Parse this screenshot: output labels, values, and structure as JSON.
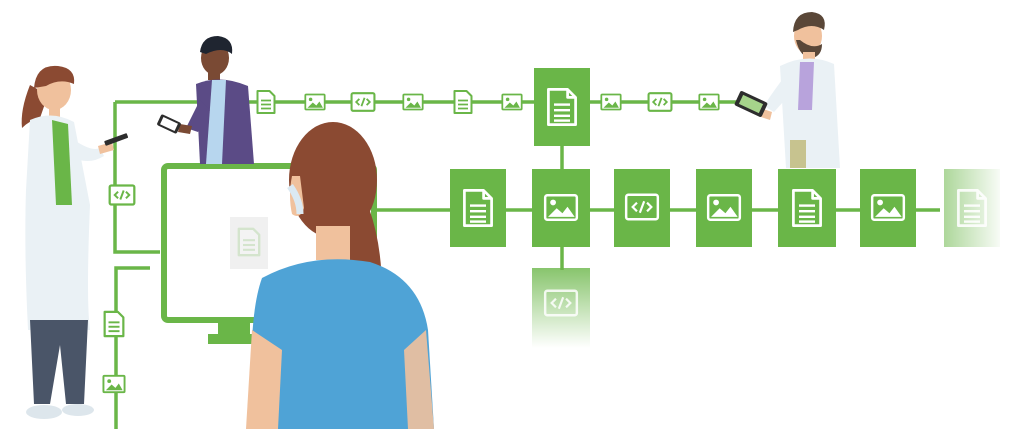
{
  "colors": {
    "accent": "#6ab648",
    "accent_light": "#e6f2df",
    "background": "#ffffff",
    "coat": "#eaf1f5",
    "scrubs_blue": "#4fa3d6",
    "hair_brown": "#8b4a32",
    "skin_tan": "#f0c19d",
    "skin_brown": "#7a4a34",
    "purple": "#5b4b86"
  },
  "icons": {
    "document": "document-icon",
    "image": "image-icon",
    "code": "code-icon"
  },
  "diagram": {
    "top_row": [
      "document",
      "image",
      "code",
      "image",
      "document",
      "image"
    ],
    "top_after_main": [
      "image",
      "code",
      "image"
    ],
    "main_row": [
      "document",
      "image",
      "code",
      "image",
      "document",
      "image",
      "document"
    ],
    "below_main": "code",
    "left_branch": [
      "code",
      "document",
      "image"
    ]
  },
  "people": [
    {
      "name": "doctor-with-phone"
    },
    {
      "name": "man-with-tablet"
    },
    {
      "name": "nurse-at-monitor"
    },
    {
      "name": "bearded-doctor-with-tablet"
    }
  ]
}
